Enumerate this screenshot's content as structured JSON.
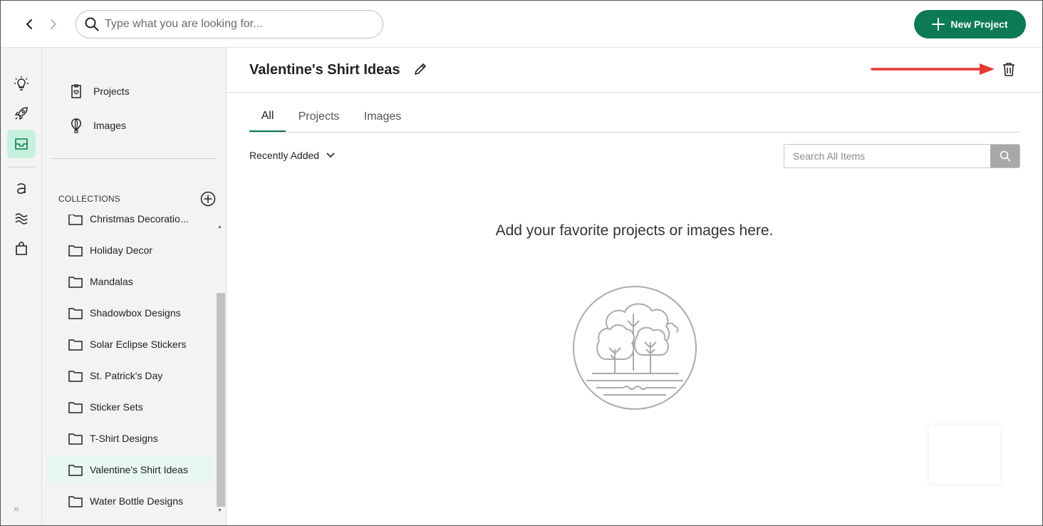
{
  "topbar": {
    "search_placeholder": "Type what you are looking for...",
    "new_project_label": "New Project"
  },
  "rail": {
    "icons": [
      "lightbulb-icon",
      "rocket-icon",
      "inbox-icon",
      "a-letter-icon",
      "waves-icon",
      "shopping-bag-icon"
    ],
    "active": "inbox-icon",
    "expand": "»"
  },
  "sidebar": {
    "links": [
      {
        "label": "Projects",
        "icon": "project-icon"
      },
      {
        "label": "Images",
        "icon": "balloon-icon"
      }
    ],
    "collections_header": "COLLECTIONS",
    "collections": [
      {
        "label": "Christmas Decoratio..."
      },
      {
        "label": "Holiday Decor"
      },
      {
        "label": "Mandalas"
      },
      {
        "label": "Shadowbox Designs"
      },
      {
        "label": "Solar Eclipse Stickers"
      },
      {
        "label": "St. Patrick's Day"
      },
      {
        "label": "Sticker Sets"
      },
      {
        "label": "T-Shirt Designs"
      },
      {
        "label": "Valentine's Shirt Ideas"
      },
      {
        "label": "Water Bottle Designs"
      }
    ],
    "active_collection": "Valentine's Shirt Ideas"
  },
  "main": {
    "title": "Valentine's Shirt Ideas",
    "tabs": [
      {
        "label": "All"
      },
      {
        "label": "Projects"
      },
      {
        "label": "Images"
      }
    ],
    "active_tab": "All",
    "sort_label": "Recently Added",
    "search_placeholder": "Search All Items",
    "empty_message": "Add your favorite projects or images here."
  },
  "colors": {
    "accent": "#0b7a55",
    "active_rail": "#c8f0df",
    "active_row": "#e8f7f0",
    "annotation_arrow": "#e53935"
  }
}
